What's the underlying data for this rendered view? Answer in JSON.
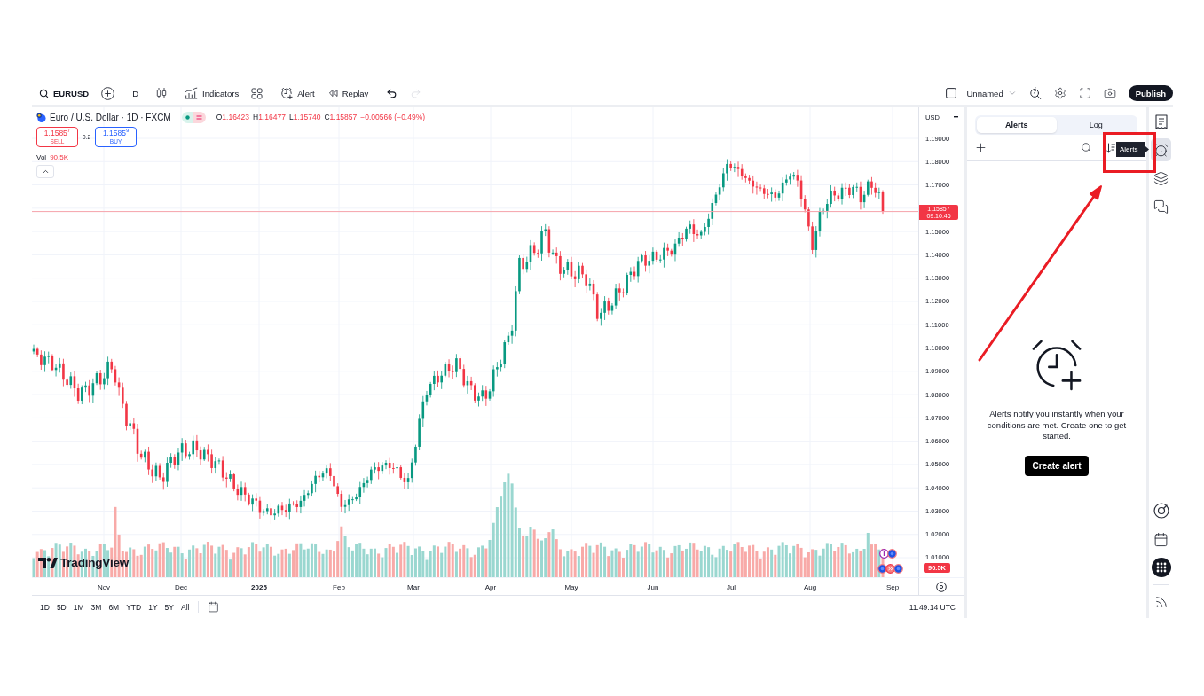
{
  "toolbar": {
    "groups": [
      [
        {
          "kind": "symbol",
          "label": "EURUSD"
        },
        {
          "kind": "compare"
        }
      ],
      [
        {
          "kind": "interval",
          "label": "D"
        }
      ],
      [
        {
          "kind": "chart-type"
        }
      ],
      [
        {
          "kind": "indicators",
          "label": "Indicators"
        },
        {
          "kind": "layouts"
        }
      ],
      [
        {
          "kind": "alert",
          "label": "Alert"
        },
        {
          "kind": "replay",
          "label": "Replay"
        }
      ],
      [
        {
          "kind": "undo",
          "disabled": false
        },
        {
          "kind": "redo",
          "disabled": true
        }
      ]
    ],
    "layout_name": "Unnamed",
    "tools": [
      {
        "kind": "quick-search"
      },
      {
        "kind": "settings"
      },
      {
        "kind": "fullscreen"
      },
      {
        "kind": "snapshot"
      }
    ],
    "publish_button": "Publish"
  },
  "legend": {
    "title": "Euro / U.S. Dollar · 1D · FXCM",
    "down": true,
    "ohlc": [
      {
        "label": "O",
        "value": "1.16423"
      },
      {
        "label": "H",
        "value": "1.16477"
      },
      {
        "label": "L",
        "value": "1.15740"
      },
      {
        "label": "C",
        "value": "1.15857"
      }
    ],
    "change": "−0.00566 (−0.49%)",
    "sell": {
      "price": "1.1585$^{7}$",
      "label": "SELL"
    },
    "spread": "0.2",
    "buy": {
      "price": "1.1585$^{9}$",
      "label": "BUY"
    },
    "volume": {
      "label": "Vol",
      "value": "90.5K"
    }
  },
  "price_scale": {
    "currency": "USD",
    "ticks": [
      {
        "kind": "tick",
        "text": "1.19000"
      },
      {
        "kind": "tick",
        "text": "1.18000"
      },
      {
        "kind": "tick",
        "text": "1.17000"
      },
      {
        "kind": "last-price",
        "price": "1.15857",
        "countdown": "09:10:46"
      },
      {
        "kind": "tick",
        "text": "1.15000"
      },
      {
        "kind": "tick",
        "text": "1.14000"
      },
      {
        "kind": "tick",
        "text": "1.13000"
      },
      {
        "kind": "tick",
        "text": "1.12000"
      },
      {
        "kind": "tick",
        "text": "1.11000"
      },
      {
        "kind": "tick",
        "text": "1.10000"
      },
      {
        "kind": "tick",
        "text": "1.09000"
      },
      {
        "kind": "tick",
        "text": "1.08000"
      },
      {
        "kind": "tick",
        "text": "1.07000"
      },
      {
        "kind": "tick",
        "text": "1.06000"
      },
      {
        "kind": "tick",
        "text": "1.05000"
      },
      {
        "kind": "tick",
        "text": "1.04000"
      },
      {
        "kind": "tick",
        "text": "1.03000"
      },
      {
        "kind": "tick",
        "text": "1.02000"
      },
      {
        "kind": "tick",
        "text": "1.01000"
      }
    ],
    "volume_label": "90.5K"
  },
  "time_scale": {
    "labels": [
      {
        "text": "Nov",
        "kind": "month"
      },
      {
        "text": "Dec",
        "kind": "month"
      },
      {
        "text": "2025",
        "kind": "year"
      },
      {
        "text": "Feb",
        "kind": "month"
      },
      {
        "text": "Mar",
        "kind": "month"
      },
      {
        "text": "Apr",
        "kind": "month"
      },
      {
        "text": "May",
        "kind": "month"
      },
      {
        "text": "Jun",
        "kind": "month"
      },
      {
        "text": "Jul",
        "kind": "month"
      },
      {
        "text": "Aug",
        "kind": "month"
      },
      {
        "text": "Sep",
        "kind": "month"
      }
    ]
  },
  "chart_logo": "TradingView",
  "range_bar": {
    "ranges": [
      "1D",
      "5D",
      "1M",
      "3M",
      "6M",
      "YTD",
      "1Y",
      "5Y",
      "All"
    ],
    "clock": "11:49:14 UTC"
  },
  "alerts_panel": {
    "tabs": [
      {
        "label": "Alerts",
        "selected": true
      },
      {
        "label": "Log",
        "selected": false
      }
    ],
    "empty_message": "Alerts notify you instantly when your conditions are met. Create one to get started.",
    "create_button": "Create alert"
  },
  "right_sidebar": {
    "top": [
      {
        "kind": "watchlist",
        "selected": false
      },
      {
        "kind": "alerts",
        "selected": true
      },
      {
        "kind": "object-tree",
        "selected": false
      },
      {
        "kind": "chats",
        "selected": false
      }
    ],
    "bottom": [
      {
        "kind": "ideas",
        "selected": false
      },
      {
        "kind": "calendar",
        "selected": false
      },
      {
        "kind": "products",
        "selected": false
      },
      {
        "kind": "signals",
        "selected": false
      }
    ],
    "tooltip": "Alerts"
  }
}
